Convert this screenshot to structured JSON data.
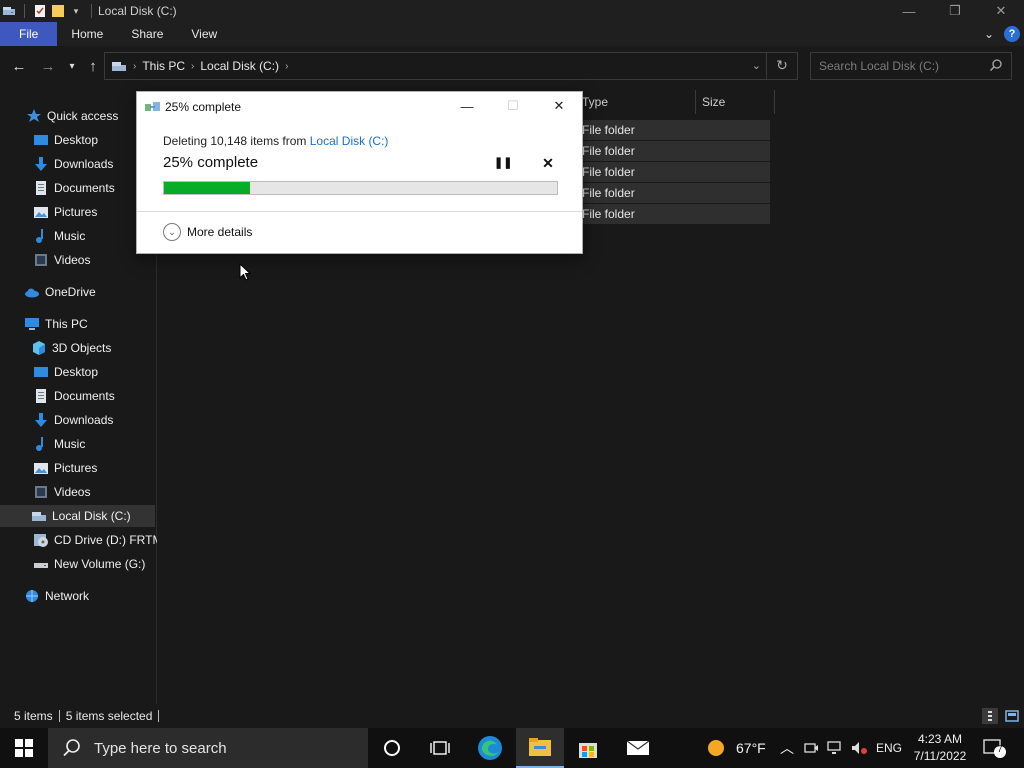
{
  "window": {
    "title": "Local Disk (C:)",
    "minimize": "—",
    "restore": "❐",
    "close": "✕"
  },
  "ribbon": {
    "tabs": [
      "File",
      "Home",
      "Share",
      "View"
    ]
  },
  "address": {
    "crumbs": [
      "This PC",
      "Local Disk (C:)"
    ],
    "search_placeholder": "Search Local Disk (C:)"
  },
  "navpane": {
    "quick_access": "Quick access",
    "quick_items": [
      "Desktop",
      "Downloads",
      "Documents",
      "Pictures",
      "Music",
      "Videos"
    ],
    "onedrive": "OneDrive",
    "this_pc": "This PC",
    "pc_items": [
      "3D Objects",
      "Desktop",
      "Documents",
      "Downloads",
      "Music",
      "Pictures",
      "Videos",
      "Local Disk (C:)",
      "CD Drive (D:) FRTME",
      "New Volume (G:)"
    ],
    "network": "Network"
  },
  "content": {
    "columns": [
      "Type",
      "Size"
    ],
    "rows": [
      "File folder",
      "File folder",
      "File folder",
      "File folder",
      "File folder"
    ]
  },
  "statusbar": {
    "items_count": "5 items",
    "selected": "5 items selected"
  },
  "dialog": {
    "title": "25% complete",
    "deleting_prefix": "Deleting 10,148 items from ",
    "deleting_location": "Local Disk (C:)",
    "progress_text": "25% complete",
    "progress_fraction": 0.22,
    "more_details": "More details"
  },
  "taskbar": {
    "search_placeholder": "Type here to search",
    "weather": "67°F",
    "language": "ENG",
    "time": "4:23 AM",
    "date": "7/11/2022",
    "notification_count": "7"
  }
}
